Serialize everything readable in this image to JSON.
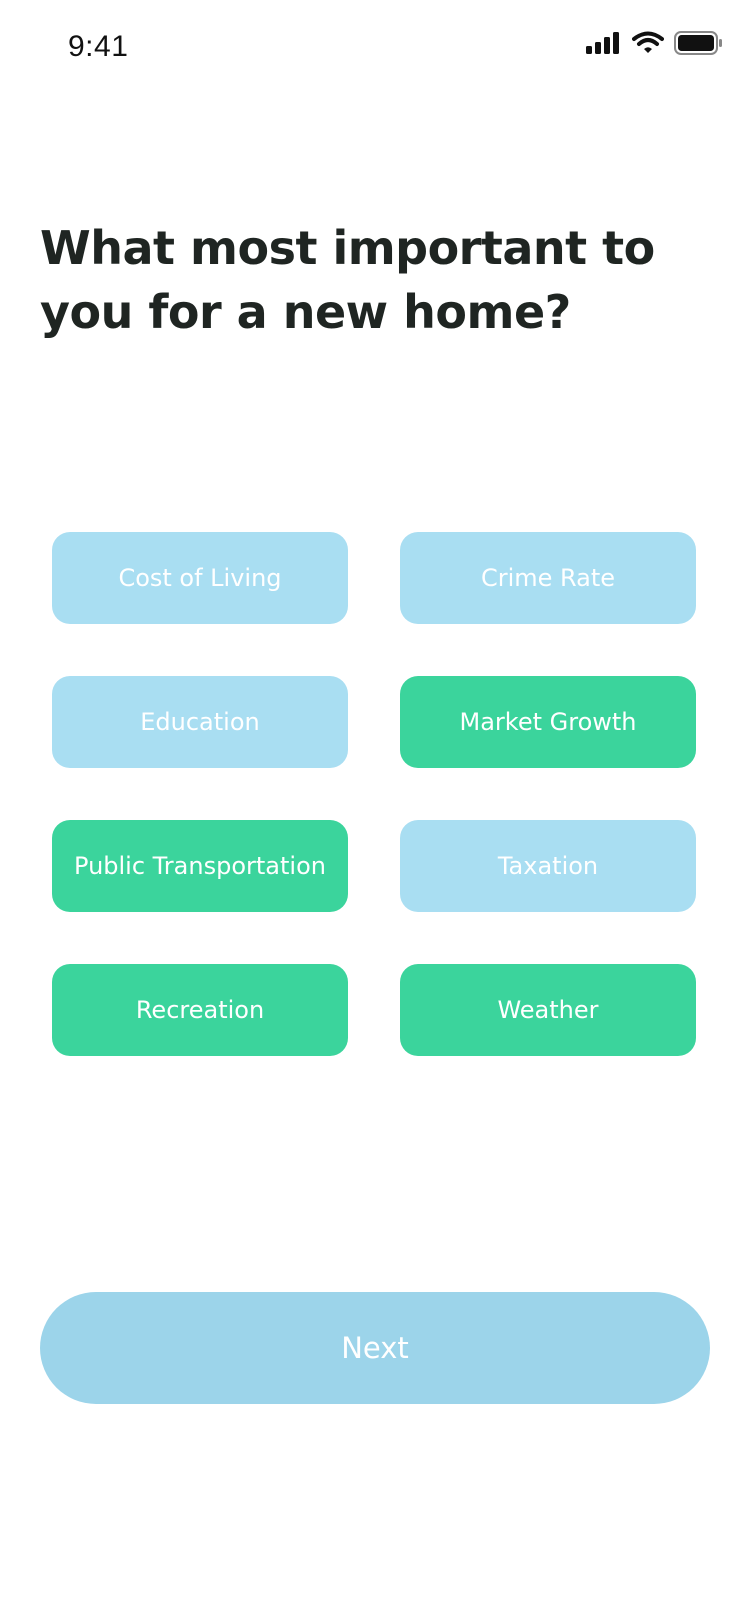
{
  "status_bar": {
    "time": "9:41",
    "icons": [
      "cellular-signal-icon",
      "wifi-icon",
      "battery-icon"
    ]
  },
  "question": "What most important to you for a new home?",
  "options": [
    {
      "label": "Cost of Living",
      "selected": false
    },
    {
      "label": "Crime Rate",
      "selected": false
    },
    {
      "label": "Education",
      "selected": false
    },
    {
      "label": "Market Growth",
      "selected": true
    },
    {
      "label": "Public Transportation",
      "selected": true
    },
    {
      "label": "Taxation",
      "selected": false
    },
    {
      "label": "Recreation",
      "selected": true
    },
    {
      "label": "Weather",
      "selected": true
    }
  ],
  "next_button": {
    "label": "Next"
  },
  "colors": {
    "unselected": "#a9def2",
    "selected": "#3bd49c",
    "next_button": "#9cd4ea",
    "title_text": "#1f2522",
    "option_text": "#ffffff"
  }
}
